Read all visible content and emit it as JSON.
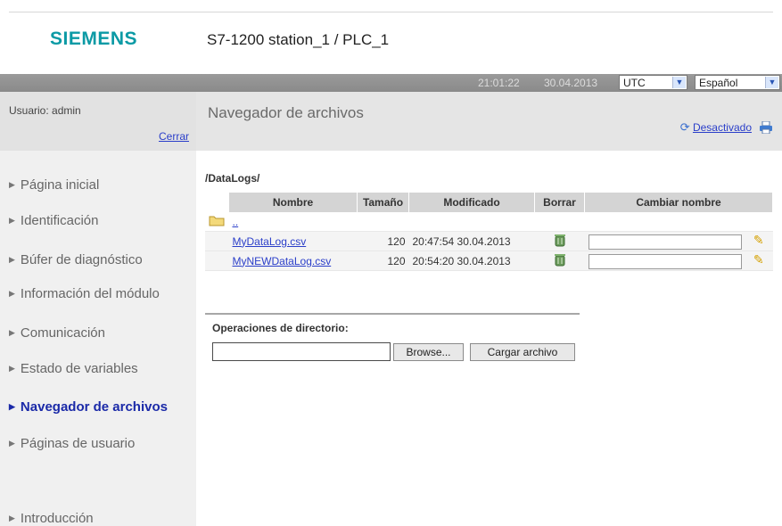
{
  "header": {
    "brand": "SIEMENS",
    "station": "S7-1200 station_1 / PLC_1"
  },
  "statusbar": {
    "time": "21:01:22",
    "date": "30.04.2013",
    "timezone": "UTC",
    "language": "Español"
  },
  "user": {
    "label": "Usuario: admin",
    "logout": "Cerrar"
  },
  "nav": {
    "items": [
      {
        "label": "Página inicial",
        "active": false
      },
      {
        "label": "Identificación",
        "active": false
      },
      {
        "label": "Búfer de diagnóstico",
        "active": false
      },
      {
        "label": "Información del módulo",
        "active": false
      },
      {
        "label": "Comunicación",
        "active": false
      },
      {
        "label": "Estado de variables",
        "active": false
      },
      {
        "label": "Navegador de archivos",
        "active": true
      },
      {
        "label": "Páginas de usuario",
        "active": false
      },
      {
        "label": "Introducción",
        "active": false
      }
    ]
  },
  "page": {
    "title": "Navegador de archivos",
    "refresh_label": "Desactivado",
    "path": "/DataLogs/"
  },
  "table": {
    "headers": [
      "Nombre",
      "Tamaño",
      "Modificado",
      "Borrar",
      "Cambiar nombre"
    ],
    "parent_link": "..",
    "rows": [
      {
        "name": "MyDataLog.csv",
        "size": "120",
        "modified": "20:47:54 30.04.2013"
      },
      {
        "name": "MyNEWDataLog.csv",
        "size": "120",
        "modified": "20:54:20 30.04.2013"
      }
    ]
  },
  "ops": {
    "label": "Operaciones de directorio:",
    "browse": "Browse...",
    "upload": "Cargar archivo"
  },
  "colors": {
    "brand": "#0b9aa5",
    "link": "#2a3ec9",
    "statusbar": "#8f8f8f",
    "sidebar": "#f0f0f0"
  }
}
